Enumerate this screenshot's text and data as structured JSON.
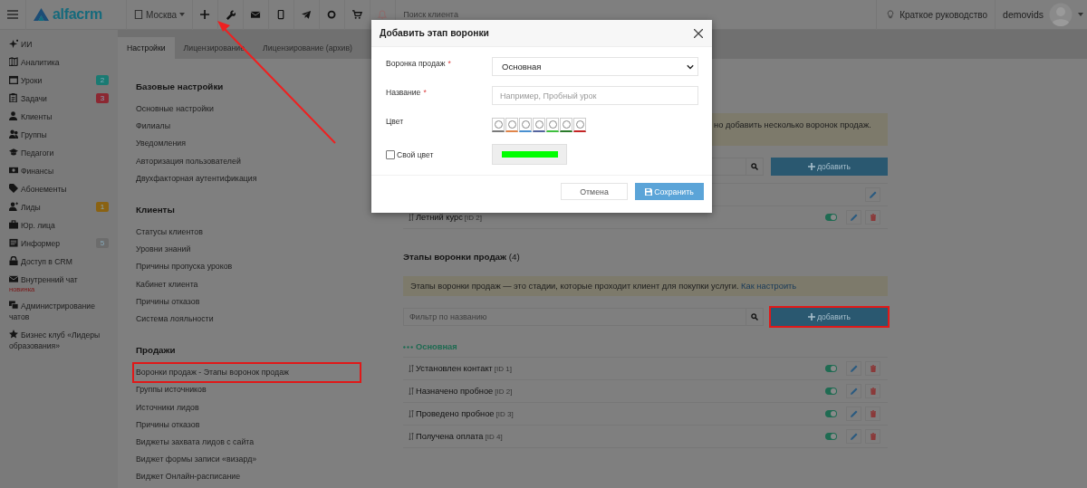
{
  "topbar": {
    "logo": "alfacrm",
    "branch": "Москва",
    "search": {
      "placeholder": "Поиск клиента"
    },
    "guide": "Краткое руководство",
    "user": "demovids"
  },
  "sidebar": {
    "items": [
      {
        "label": "ИИ"
      },
      {
        "label": "Аналитика"
      },
      {
        "label": "Уроки",
        "badge": "2",
        "color": "#1a7a72"
      },
      {
        "label": "Задачи",
        "badge": "3",
        "color": "#8c2832"
      },
      {
        "label": "Клиенты"
      },
      {
        "label": "Группы"
      },
      {
        "label": "Педагоги"
      },
      {
        "label": "Финансы"
      },
      {
        "label": "Абонементы"
      },
      {
        "label": "Лиды",
        "badge": "1",
        "color": "#8a6212"
      },
      {
        "label": "Юр. лица"
      },
      {
        "label": "Информер",
        "badge": "5",
        "color": "#6c6c6c"
      },
      {
        "label": "Доступ в CRM"
      },
      {
        "label": "Внутренний чат",
        "note": "новинка"
      },
      {
        "label": "Администрирование чатов"
      },
      {
        "label": "Бизнес клуб «Лидеры образования»"
      }
    ]
  },
  "tabs": [
    {
      "label": "Настройки",
      "selected": true
    },
    {
      "label": "Лицензирование",
      "selected": false
    },
    {
      "label": "Лицензирование (архив)",
      "selected": false
    }
  ],
  "settings": {
    "groups": [
      {
        "title": "Базовые настройки",
        "items": [
          {
            "label": "Основные настройки",
            "highlighted": false
          },
          {
            "label": "Филиалы",
            "highlighted": false
          },
          {
            "label": "Уведомления",
            "highlighted": false
          },
          {
            "label": "Авторизация пользователей",
            "highlighted": false
          },
          {
            "label": "Двухфакторная аутентификация",
            "highlighted": false
          }
        ]
      },
      {
        "title": "Клиенты",
        "items": [
          {
            "label": "Статусы клиентов",
            "highlighted": false
          },
          {
            "label": "Уровни знаний",
            "highlighted": false
          },
          {
            "label": "Причины пропуска уроков",
            "highlighted": false
          },
          {
            "label": "Кабинет клиента",
            "highlighted": false
          },
          {
            "label": "Причины отказов",
            "highlighted": false
          },
          {
            "label": "Система лояльности",
            "highlighted": false
          }
        ]
      },
      {
        "title": "Продажи",
        "items": [
          {
            "label": "Воронки продаж - Этапы воронок продаж",
            "highlighted": true
          },
          {
            "label": "Группы источников",
            "highlighted": false
          },
          {
            "label": "Источники лидов",
            "highlighted": false
          },
          {
            "label": "Причины отказов",
            "highlighted": false
          },
          {
            "label": "Виджеты захвата лидов с сайта",
            "highlighted": false
          },
          {
            "label": "Виджет формы записи «визард»",
            "highlighted": false
          },
          {
            "label": "Виджет Онлайн-расписание",
            "highlighted": false
          }
        ]
      }
    ]
  },
  "funnels": {
    "notice": "но добавить несколько воронок продаж.",
    "add_button": {
      "label": "добавить",
      "highlighted": false
    },
    "rows": [
      {
        "kind": "default"
      },
      {
        "kind": "regular",
        "name": "Летний курс",
        "id": "[ID 2]",
        "enabled": true
      }
    ]
  },
  "stages": {
    "title": "Этапы воронки продаж",
    "count": "(4)",
    "notice": "Этапы воронки продаж — это стадии, которые проходит клиент для покупки услуги.",
    "link": "Как настроить",
    "filter": {
      "placeholder": "Фильтр по названию"
    },
    "add_button": {
      "label": "добавить",
      "highlighted": true
    },
    "funnel": "Основная",
    "rows": [
      {
        "kind": "regular",
        "name": "Установлен контакт",
        "id": "[ID 1]",
        "enabled": true
      },
      {
        "kind": "regular",
        "name": "Назначено пробное",
        "id": "[ID 2]",
        "enabled": true
      },
      {
        "kind": "regular",
        "name": "Проведено пробное",
        "id": "[ID 3]",
        "enabled": true
      },
      {
        "kind": "regular",
        "name": "Получена оплата",
        "id": "[ID 4]",
        "enabled": true
      }
    ]
  },
  "modal": {
    "title": "Добавить этап воронки",
    "fields": [
      {
        "kind": "select",
        "label": "Воронка продаж",
        "required_mark": "*",
        "value": "Основная"
      },
      {
        "kind": "text",
        "label": "Название",
        "required_mark": "*",
        "placeholder": "Например, Пробный урок"
      },
      {
        "kind": "colors",
        "label": "Цвет",
        "swatches": [
          {
            "color": "#7a7a7a",
            "selected": false
          },
          {
            "color": "#e0854a",
            "selected": false
          },
          {
            "color": "#4a90d0",
            "selected": false
          },
          {
            "color": "#55649e",
            "selected": false
          },
          {
            "color": "#3fbf3f",
            "selected": false
          },
          {
            "color": "#2a7a2a",
            "selected": false
          },
          {
            "color": "#c42525",
            "selected": false
          }
        ]
      },
      {
        "kind": "custom",
        "label": "Свой цвет",
        "checked": false,
        "color": "#00ff00"
      }
    ],
    "buttons": [
      {
        "kind": "cancel",
        "label": "Отмена"
      },
      {
        "kind": "primary",
        "label": "Сохранить"
      }
    ]
  }
}
